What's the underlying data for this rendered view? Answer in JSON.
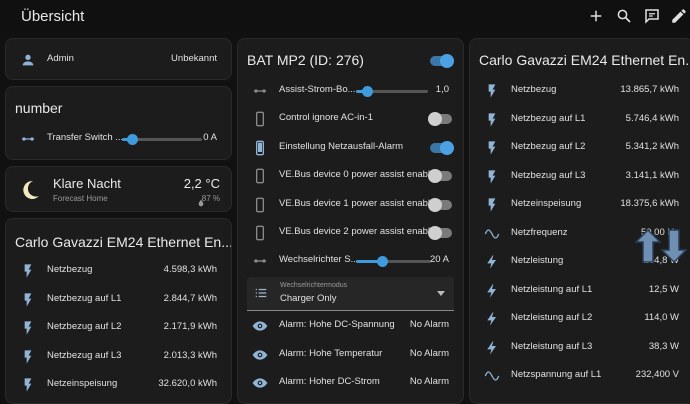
{
  "header": {
    "title": "Übersicht"
  },
  "user_card": {
    "name": "Admin",
    "status": "Unbekannt"
  },
  "number_card": {
    "title": "number",
    "row_label": "Transfer Switch ...",
    "row_value": "0 A",
    "level": 0.12
  },
  "weather": {
    "condition": "Klare Nacht",
    "location": "Forecast Home",
    "temperature": "2,2 °C",
    "humidity": "87 %"
  },
  "em24_left": {
    "title": "Carlo Gavazzi EM24 Ethernet En...",
    "rows": [
      {
        "label": "Netzbezug",
        "value": "4.598,3 kWh"
      },
      {
        "label": "Netzbezug auf L1",
        "value": "2.844,7 kWh"
      },
      {
        "label": "Netzbezug auf L2",
        "value": "2.171,9 kWh"
      },
      {
        "label": "Netzbezug auf L3",
        "value": "2.013,3 kWh"
      },
      {
        "label": "Netzeinspeisung",
        "value": "32.620,0 kWh"
      }
    ]
  },
  "bat": {
    "title": "BAT MP2 (ID: 276)",
    "assist": {
      "label": "Assist-Strom-Bo...",
      "value": "1,0",
      "level": 0.15
    },
    "toggles": [
      {
        "label": "Control ignore AC-in-1",
        "on": false
      },
      {
        "label": "Einstellung Netzausfall-Alarm",
        "on": true
      },
      {
        "label": "VE.Bus device 0 power assist enabled",
        "on": false
      },
      {
        "label": "VE.Bus device 1 power assist enabled",
        "on": false
      },
      {
        "label": "VE.Bus device 2 power assist enabled",
        "on": false
      }
    ],
    "inverter": {
      "label": "Wechselrichter S...",
      "value": "20 A",
      "level": 0.34
    },
    "mode": {
      "caption": "Wechselrichtermodus",
      "value": "Charger Only"
    },
    "alarms": [
      {
        "label": "Alarm: Hohe DC-Spannung",
        "value": "No Alarm"
      },
      {
        "label": "Alarm: Hohe Temperatur",
        "value": "No Alarm"
      },
      {
        "label": "Alarm: Hoher DC-Strom",
        "value": "No Alarm"
      }
    ]
  },
  "em24_right": {
    "title": "Carlo Gavazzi EM24 Ethernet En...",
    "rows": [
      {
        "label": "Netzbezug",
        "value": "13.865,7 kWh",
        "icon": "flash"
      },
      {
        "label": "Netzbezug auf L1",
        "value": "5.746,4 kWh",
        "icon": "flash"
      },
      {
        "label": "Netzbezug auf L2",
        "value": "5.341,2 kWh",
        "icon": "flash"
      },
      {
        "label": "Netzbezug auf L3",
        "value": "3.141,1 kWh",
        "icon": "flash"
      },
      {
        "label": "Netzeinspeisung",
        "value": "18.375,6 kWh",
        "icon": "flash"
      },
      {
        "label": "Netzfrequenz",
        "value": "50,00 Hz",
        "icon": "sine"
      },
      {
        "label": "Netzleistung",
        "value": "164,8 W",
        "icon": "bolt"
      },
      {
        "label": "Netzleistung auf L1",
        "value": "12,5 W",
        "icon": "bolt"
      },
      {
        "label": "Netzleistung auf L2",
        "value": "114,0 W",
        "icon": "bolt"
      },
      {
        "label": "Netzleistung auf L3",
        "value": "38,3 W",
        "icon": "bolt"
      },
      {
        "label": "Netzspannung auf L1",
        "value": "232,400 V",
        "icon": "sine"
      }
    ]
  },
  "colors": {
    "accent": "#3f9bdc",
    "background": "#111111",
    "card": "#1c1c1c"
  }
}
